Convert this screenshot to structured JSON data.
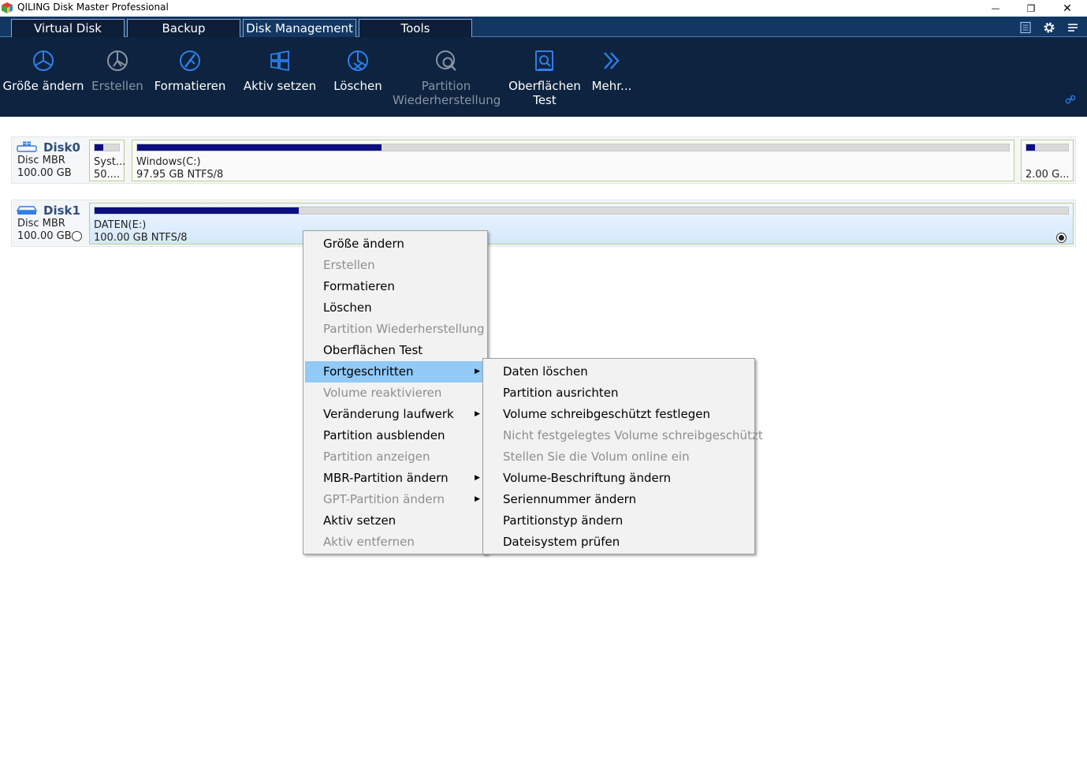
{
  "window": {
    "title": "QILING Disk Master Professional",
    "minimize_glyph": "—",
    "restore_glyph": "❐",
    "close_glyph": "✕"
  },
  "tabs": [
    {
      "label": "Virtual Disk"
    },
    {
      "label": "Backup"
    },
    {
      "label": "Disk Management",
      "active": true
    },
    {
      "label": "Tools"
    }
  ],
  "toolbar": {
    "buttons": [
      {
        "label": "Größe ändern",
        "icon": "resize-pie-icon",
        "enabled": true
      },
      {
        "label": "Erstellen",
        "icon": "create-pie-icon",
        "enabled": false
      },
      {
        "label": "Formatieren",
        "icon": "format-brush-icon",
        "enabled": true
      },
      {
        "label": "Aktiv setzen",
        "icon": "windows-flag-icon",
        "enabled": true
      },
      {
        "label": "Löschen",
        "icon": "delete-pie-icon",
        "enabled": true
      },
      {
        "label": "Partition\nWiederherstellung",
        "icon": "partition-recovery-icon",
        "enabled": false
      },
      {
        "label": "Oberflächen\nTest",
        "icon": "surface-test-icon",
        "enabled": true
      },
      {
        "label": "Mehr...",
        "icon": "double-chevron-icon",
        "enabled": true
      }
    ]
  },
  "disks": [
    {
      "name": "Disk0",
      "type": "Disc MBR",
      "size": "100.00 GB",
      "partitions": [
        {
          "name": "Syst...",
          "info": "50....",
          "used_fraction": 0.35
        },
        {
          "name": "Windows(C:)",
          "info": "97.95 GB NTFS/8",
          "used_fraction": 0.28
        },
        {
          "name": "",
          "info": "2.00 G...",
          "used_fraction": 0.2
        }
      ]
    },
    {
      "name": "Disk1",
      "type": "Disc MBR",
      "size": "100.00 GB",
      "partitions": [
        {
          "name": "DATEN(E:)",
          "info": "100.00 GB NTFS/8",
          "used_fraction": 0.21,
          "selected": true
        }
      ]
    }
  ],
  "context_menu": {
    "items": [
      {
        "label": "Größe ändern",
        "enabled": true
      },
      {
        "label": "Erstellen",
        "enabled": false
      },
      {
        "label": "Formatieren",
        "enabled": true
      },
      {
        "label": "Löschen",
        "enabled": true
      },
      {
        "label": "Partition Wiederherstellung",
        "enabled": false
      },
      {
        "label": "Oberflächen Test",
        "enabled": true
      },
      {
        "label": "Fortgeschritten",
        "enabled": true,
        "submenu": true,
        "highlighted": true
      },
      {
        "label": "Volume reaktivieren",
        "enabled": false
      },
      {
        "label": "Veränderung laufwerk",
        "enabled": true,
        "submenu": true
      },
      {
        "label": "Partition ausblenden",
        "enabled": true
      },
      {
        "label": "Partition anzeigen",
        "enabled": false
      },
      {
        "label": "MBR-Partition ändern",
        "enabled": true,
        "submenu": true
      },
      {
        "label": "GPT-Partition ändern",
        "enabled": false,
        "submenu": true
      },
      {
        "label": "Aktiv setzen",
        "enabled": true
      },
      {
        "label": "Aktiv entfernen",
        "enabled": false
      }
    ],
    "submenu_arrow": "▶"
  },
  "submenu": {
    "items": [
      {
        "label": "Daten löschen",
        "enabled": true
      },
      {
        "label": "Partition ausrichten",
        "enabled": true
      },
      {
        "label": "Volume schreibgeschützt festlegen",
        "enabled": true
      },
      {
        "label": "Nicht festgelegtes Volume schreibgeschützt",
        "enabled": false
      },
      {
        "label": "Stellen Sie die Volum online ein",
        "enabled": false
      },
      {
        "label": "Volume-Beschriftung ändern",
        "enabled": true
      },
      {
        "label": "Seriennummer ändern",
        "enabled": true
      },
      {
        "label": "Partitionstyp ändern",
        "enabled": true
      },
      {
        "label": "Dateisystem prüfen",
        "enabled": true
      }
    ]
  },
  "colors": {
    "accent_blue": "#2f7fe8",
    "toolbar_bg": "#0d2340",
    "usage_fill": "#0c0f80",
    "menu_highlight": "#91c9f7"
  }
}
